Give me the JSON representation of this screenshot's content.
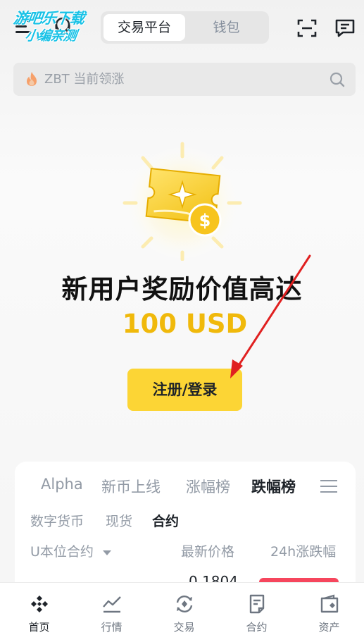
{
  "watermark": {
    "line1": "游吧乐下载",
    "line2": "小编亲测"
  },
  "header": {
    "tabs": [
      {
        "label": "交易平台",
        "active": true
      },
      {
        "label": "钱包",
        "active": false
      }
    ],
    "icons": [
      "menu-icon",
      "support-icon",
      "scan-icon",
      "message-icon"
    ]
  },
  "search": {
    "placeholder": "ZBT 当前领涨",
    "icon": "fire-icon"
  },
  "hero": {
    "title": "新用户奖励价值高达",
    "amount": "100 USD",
    "cta_label": "注册/登录"
  },
  "market": {
    "category_tabs": [
      {
        "label": "Alpha",
        "active": false
      },
      {
        "label": "新币上线",
        "active": false
      },
      {
        "label": "涨幅榜",
        "active": false
      },
      {
        "label": "跌幅榜",
        "active": true
      }
    ],
    "sub_tabs": [
      {
        "label": "数字货币",
        "active": false
      },
      {
        "label": "现货",
        "active": false
      },
      {
        "label": "合约",
        "active": true
      }
    ],
    "columns": {
      "pair": "U本位合约",
      "price": "最新价格",
      "change": "24h涨跌幅"
    },
    "first_row": {
      "price": "0.1804"
    }
  },
  "bottom_nav": [
    {
      "label": "首页",
      "icon": "home-icon",
      "active": true
    },
    {
      "label": "行情",
      "icon": "market-icon",
      "active": false
    },
    {
      "label": "交易",
      "icon": "trade-icon",
      "active": false
    },
    {
      "label": "合约",
      "icon": "futures-icon",
      "active": false
    },
    {
      "label": "资产",
      "icon": "wallet-icon",
      "active": false
    }
  ],
  "colors": {
    "brand_yellow": "#fcd535",
    "amount_gold": "#f0b90b",
    "down_red": "#f6465d",
    "annotation_arrow": "#e02020",
    "watermark": "#19c2e6"
  }
}
